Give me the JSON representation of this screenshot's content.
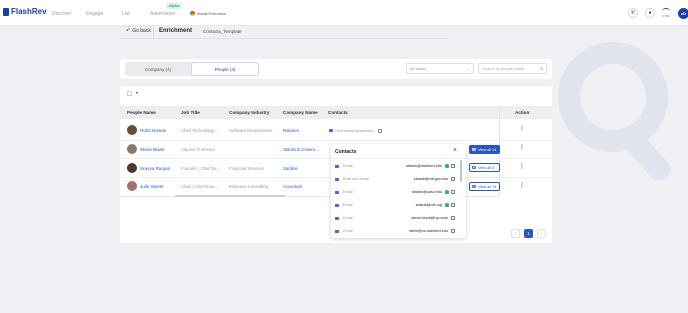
{
  "app": {
    "name": "FlashRev"
  },
  "nav": {
    "items": [
      "Discover",
      "Engage",
      "List",
      "Automation"
    ],
    "alpha_badge": "Alpha",
    "install_extension": "Install Extension",
    "credits": "2.5M",
    "avatar_initials": "eD"
  },
  "subheader": {
    "go_back": "Go back",
    "title": "Enrichment",
    "breadcrumb": "Contacts_Template"
  },
  "tabs": [
    {
      "label": "Company (4)",
      "active": false
    },
    {
      "label": "People (4)",
      "active": true
    }
  ],
  "filters": {
    "status_placeholder": "All status",
    "search_placeholder": "Search by people name"
  },
  "table": {
    "columns": [
      "People Name",
      "Job Title",
      "Company Industry",
      "Company Name",
      "Contacts",
      "Action"
    ],
    "rows": [
      {
        "name": "Rohit Dewan",
        "job": "Chief Technology ...",
        "industry": "Software Development",
        "company": "Rakuten",
        "contact": "rohit.dewan@rakuten...",
        "view_all": ""
      },
      {
        "name": "Steve Blank",
        "job": "Adjunct Professor",
        "industry": "",
        "company": "Stanford Univers...",
        "contact": "",
        "view_all": "View all 14"
      },
      {
        "name": "Sravya Ranjan",
        "job": "Founder | Chief Ex...",
        "industry": "Financial Services",
        "company": "Sardine",
        "contact": "",
        "view_all": "View all 3"
      },
      {
        "name": "Julie Sweet",
        "job": "Chair | Chief Exec...",
        "industry": "Business Consulting ...",
        "company": "Accenture",
        "contact": "",
        "view_all": "View all 13"
      }
    ]
  },
  "popover": {
    "title": "Contacts",
    "rows": [
      {
        "type": "Email",
        "value": "sblank@stanford.edu",
        "verified": "green"
      },
      {
        "type": "Business Email",
        "value": "sblank@mit.gov.edu",
        "verified": ""
      },
      {
        "type": "Email",
        "value": "sblank@ucsc.edu",
        "verified": "green"
      },
      {
        "type": "Email",
        "value": "sblank@mit.org",
        "verified": "green"
      },
      {
        "type": "Email",
        "value": "steve.blank@nyu.edu",
        "verified": ""
      },
      {
        "type": "Email",
        "value": "steve@cs.stanford.edu",
        "verified": ""
      }
    ]
  },
  "pagination": {
    "prev": "‹",
    "current": "1",
    "next": "›"
  },
  "colors": {
    "brand": "#1b3fae",
    "link": "#2a55c5",
    "verified": "#2fb36b"
  }
}
